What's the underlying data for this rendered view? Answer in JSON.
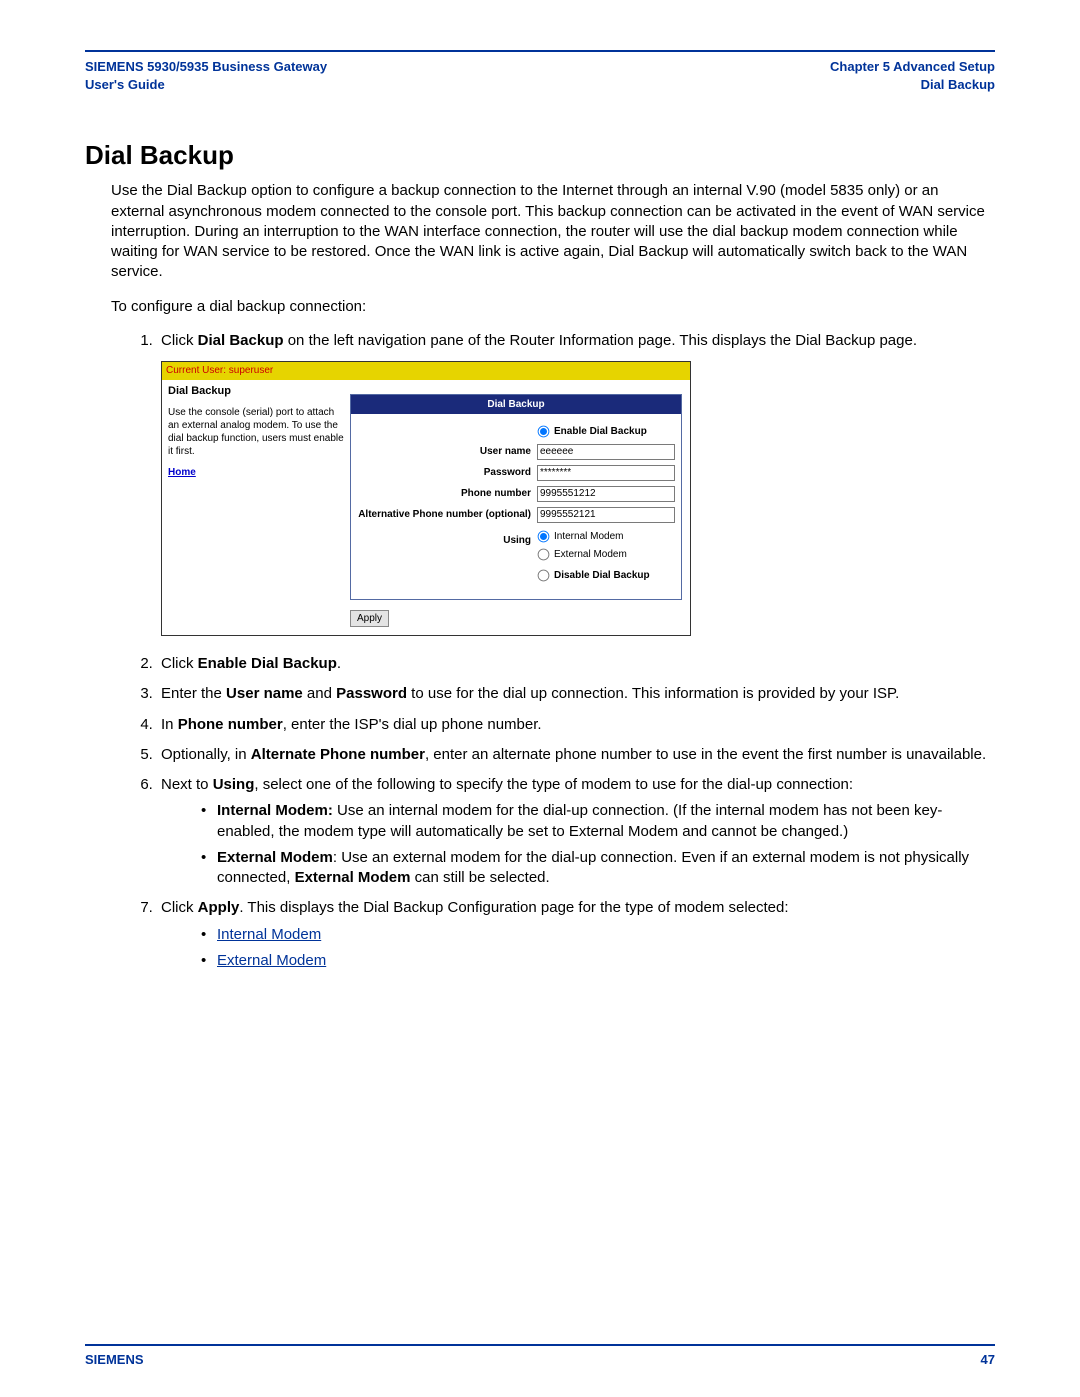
{
  "header": {
    "leftLine1": "SIEMENS 5930/5935 Business Gateway",
    "leftLine2": "User's Guide",
    "rightLine1": "Chapter 5  Advanced Setup",
    "rightLine2": "Dial Backup"
  },
  "title": "Dial Backup",
  "intro": "Use the Dial Backup option to configure a backup connection to the Internet through an internal V.90 (model 5835 only) or an external asynchronous modem connected to the console port. This backup connection can be activated in the event of WAN service interruption. During an interruption to the WAN interface connection, the router will use the dial backup modem connection while waiting for WAN service to be restored. Once the WAN link is active again, Dial Backup will automatically switch back to the WAN service.",
  "lead": "To configure a dial backup connection:",
  "steps": {
    "s1a": "Click ",
    "s1b": "Dial Backup",
    "s1c": " on the left navigation pane of the Router Information page. This displays the Dial Backup page.",
    "s2a": "Click ",
    "s2b": "Enable Dial Backup",
    "s2c": ".",
    "s3a": "Enter the ",
    "s3b": "User name",
    "s3c": " and ",
    "s3d": "Password",
    "s3e": " to use for the dial up connection. This information is provided by your ISP.",
    "s4a": "In ",
    "s4b": "Phone number",
    "s4c": ", enter the ISP's dial up phone number.",
    "s5a": "Optionally, in ",
    "s5b": "Alternate Phone number",
    "s5c": ", enter an alternate phone number to use in the event the first number is unavailable.",
    "s6a": "Next to ",
    "s6b": "Using",
    "s6c": ", select one of the following to specify the type of modem to use for the dial-up connection:",
    "s6_b1a": "Internal Modem:",
    "s6_b1b": " Use an internal modem for the dial-up connection. (If the internal modem has not been key-enabled, the modem type will automatically be set to External Modem and cannot be changed.)",
    "s6_b2a": "External Modem",
    "s6_b2b": ": Use an external modem for the dial-up connection. Even if an external modem is not physically connected, ",
    "s6_b2c": "External Modem",
    "s6_b2d": " can still be selected.",
    "s7a": "Click ",
    "s7b": "Apply",
    "s7c": ". This displays the Dial Backup Configuration page for the type of modem selected:",
    "s7_link1": "Internal Modem",
    "s7_link2": "External Modem"
  },
  "ui": {
    "userbar": "Current User: superuser",
    "side_title": "Dial Backup",
    "side_text": "Use the console (serial) port to attach an external analog modem. To use the dial backup function, users must enable it first.",
    "home": "Home",
    "panel_title": "Dial Backup",
    "enable_label": "Enable Dial Backup",
    "disable_label": "Disable Dial Backup",
    "user_label": "User name",
    "user_val": "eeeeee",
    "pass_label": "Password",
    "pass_val": "********",
    "phone_label": "Phone number",
    "phone_val": "9995551212",
    "alt_label": "Alternative Phone number (optional)",
    "alt_val": "9995552121",
    "using_label": "Using",
    "internal": "Internal Modem",
    "external": "External Modem",
    "apply": "Apply"
  },
  "footer": {
    "left": "SIEMENS",
    "right": "47"
  }
}
